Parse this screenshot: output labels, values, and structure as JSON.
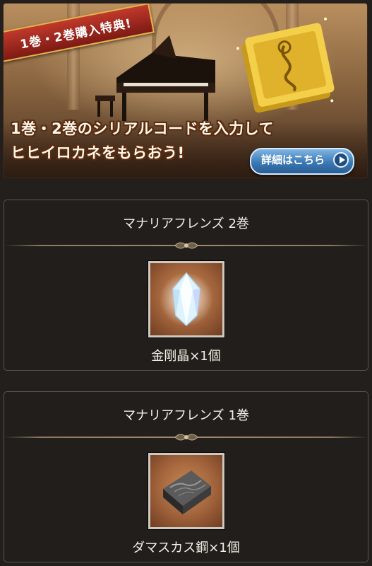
{
  "banner": {
    "ribbon": "1巻・2巻購入特典!",
    "headline_line1": "1巻・2巻のシリアルコードを入力して",
    "headline_line2": "ヒヒイロカネをもらおう!",
    "detail_button": "詳細はこちら",
    "colors": {
      "button": "#3b79b5",
      "ribbon": "#c0392b"
    }
  },
  "rewards": [
    {
      "title": "マナリアフレンズ 2巻",
      "item": "金剛晶×1個",
      "icon": "crystal-icon"
    },
    {
      "title": "マナリアフレンズ 1巻",
      "item": "ダマスカス鋼×1個",
      "icon": "damascus-ingot-icon"
    }
  ]
}
